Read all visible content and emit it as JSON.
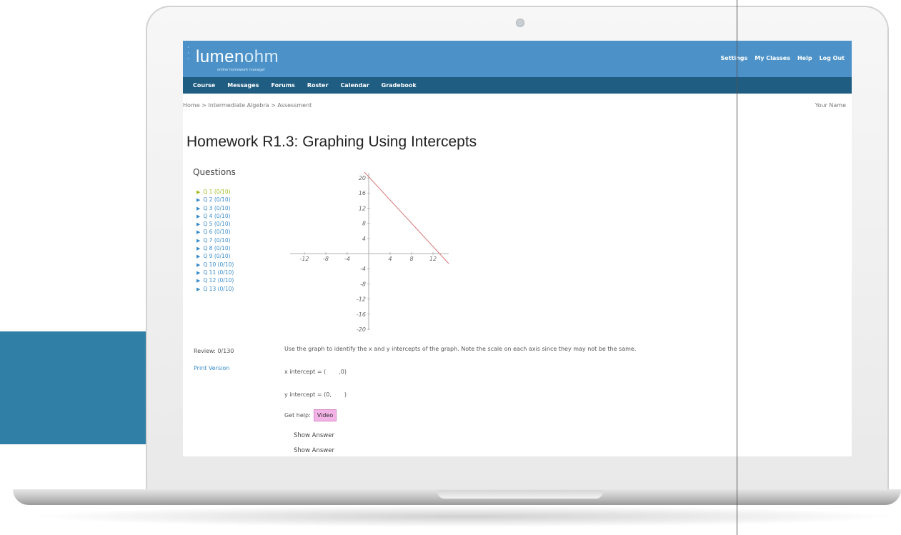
{
  "app": {
    "logo_main": "lumen",
    "logo_accent": "ohm",
    "tagline": "online homework manager"
  },
  "top_links": [
    "Settings",
    "My Classes",
    "Help",
    "Log Out"
  ],
  "nav": [
    "Course",
    "Messages",
    "Forums",
    "Roster",
    "Calendar",
    "Gradebook"
  ],
  "breadcrumb": "Home > Intermediate Algebra > Assessment",
  "user_name": "Your Name",
  "page_title": "Homework R1.3: Graphing Using Intercepts",
  "sidebar": {
    "heading": "Questions",
    "questions": [
      "Q 1 (0/10)",
      "Q 2 (0/10)",
      "Q 3 (0/10)",
      "Q 4 (0/10)",
      "Q 5 (0/10)",
      "Q 6 (0/10)",
      "Q 7 (0/10)",
      "Q 8 (0/10)",
      "Q 9 (0/10)",
      "Q 10 (0/10)",
      "Q 11 (0/10)",
      "Q 12 (0/10)",
      "Q 13 (0/10)"
    ],
    "review": "Review: 0/130",
    "print_label": "Print Version"
  },
  "graph": {
    "x_ticks": [
      "-12",
      "-8",
      "-4",
      "4",
      "8",
      "12"
    ],
    "y_ticks": [
      "20",
      "16",
      "12",
      "8",
      "4",
      "-4",
      "-8",
      "-12",
      "-16",
      "-20"
    ],
    "line_color": "#d97a7a"
  },
  "question": {
    "instruction": "Use the graph to identify the x and y intercepts of the graph. Note the scale on each axis since they may not be the same.",
    "x_intercept_prefix": "x intercept = (",
    "x_intercept_suffix": ",0)",
    "y_intercept_prefix": "y intercept = (0,",
    "y_intercept_suffix": ")",
    "help_label": "Get help:",
    "video_label": "Video",
    "show_answer": [
      "Show Answer",
      "Show Answer"
    ]
  },
  "colors": {
    "header": "#4c92c8",
    "nav": "#1f5d82",
    "link": "#3a8cc9",
    "active_question": "#9fbd1d",
    "video_button": "#f3b3e6"
  }
}
